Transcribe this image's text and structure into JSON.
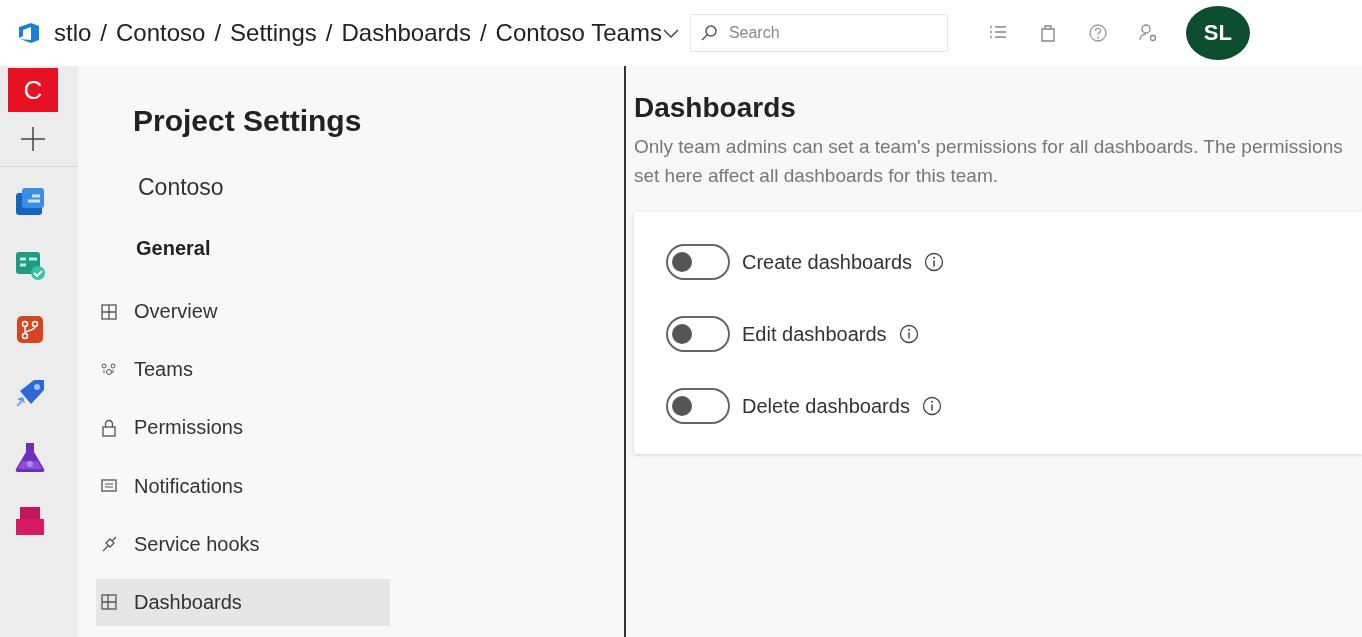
{
  "breadcrumb": {
    "separator": "/",
    "items": [
      {
        "label": "stlo"
      },
      {
        "label": "Contoso"
      },
      {
        "label": "Settings"
      },
      {
        "label": "Dashboards"
      },
      {
        "label": "Contoso Teams"
      }
    ]
  },
  "search": {
    "placeholder": "Search"
  },
  "avatar": {
    "initials": "SL"
  },
  "rail": {
    "org_initial": "C",
    "apps": [
      {
        "kind": "boards"
      },
      {
        "kind": "test-check"
      },
      {
        "kind": "repos"
      },
      {
        "kind": "pipelines"
      },
      {
        "kind": "flask"
      },
      {
        "kind": "artifacts"
      }
    ]
  },
  "settings_nav": {
    "title": "Project Settings",
    "project": "Contoso",
    "section": "General",
    "items": [
      {
        "label": "Overview",
        "kind": "overview",
        "selected": false
      },
      {
        "label": "Teams",
        "kind": "teams",
        "selected": false
      },
      {
        "label": "Permissions",
        "kind": "lock",
        "selected": false
      },
      {
        "label": "Notifications",
        "kind": "message",
        "selected": false
      },
      {
        "label": "Service hooks",
        "kind": "plug",
        "selected": false
      },
      {
        "label": "Dashboards",
        "kind": "grid",
        "selected": true
      }
    ]
  },
  "page": {
    "title": "Dashboards",
    "description": "Only team admins can set a team's permissions for all dashboards. The permissions set here affect all dashboards for this team.",
    "permissions": [
      {
        "label": "Create dashboards",
        "on": false
      },
      {
        "label": "Edit dashboards",
        "on": false
      },
      {
        "label": "Delete dashboards",
        "on": false
      }
    ]
  }
}
